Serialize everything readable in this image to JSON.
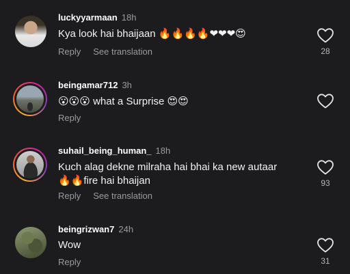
{
  "comments": [
    {
      "username": "luckyyarmaan",
      "time": "18h",
      "text": "Kya look hai bhaijaan 🔥🔥🔥🔥❤❤❤😍",
      "reply": "Reply",
      "see_translation": "See translation",
      "likes": "28"
    },
    {
      "username": "beingamar712",
      "time": "3h",
      "text": "😮😮😮 what a Surprise 😍😍",
      "reply": "Reply",
      "likes": ""
    },
    {
      "username": "suhail_being_human_",
      "time": "18h",
      "text_line1": "Kuch alag dekne milraha hai bhai ka new autaar",
      "text_line2": "🔥🔥fire hai bhaijan",
      "reply": "Reply",
      "see_translation": "See translation",
      "likes": "93"
    },
    {
      "username": "beingrizwan7",
      "time": "24h",
      "text": "Wow",
      "reply": "Reply",
      "likes": "31"
    }
  ],
  "icons": {
    "like": "heart-outline-icon"
  },
  "colors": {
    "background": "#1c1c1e",
    "secondary_text": "#9a9aa0"
  }
}
